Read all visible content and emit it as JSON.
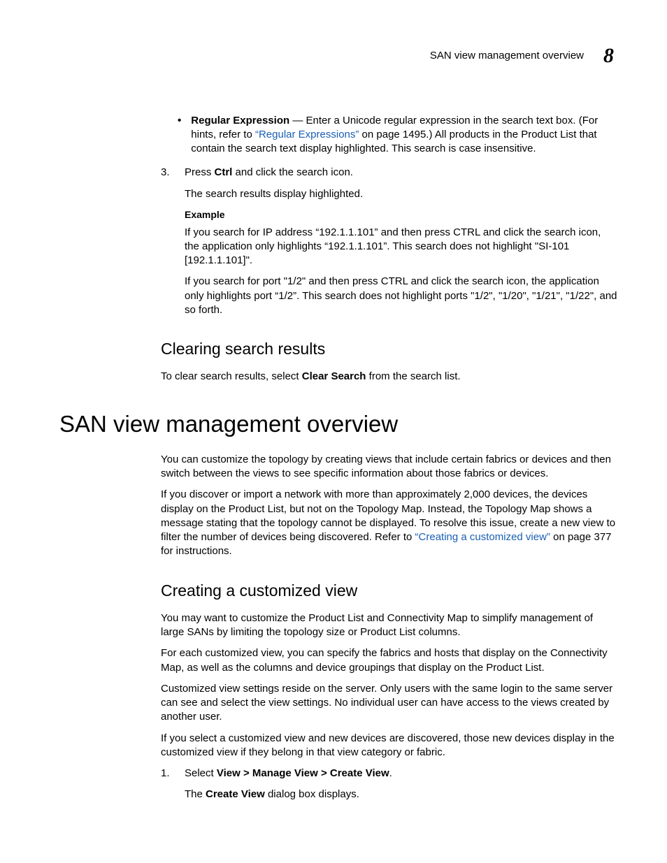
{
  "runningHead": {
    "title": "SAN view management overview",
    "chapter": "8"
  },
  "bullet": {
    "lead": "Regular Expression",
    "before": " — Enter a Unicode regular expression in the search text box. (For hints, refer to ",
    "link": "“Regular Expressions”",
    "after": " on page 1495.) All products in the Product List that contain the search text display highlighted. This search is case insensitive."
  },
  "step3": {
    "num": "3.",
    "pre": "Press ",
    "bold": "Ctrl",
    "post": " and click the search icon.",
    "result": "The search results display highlighted.",
    "exampleLabel": "Example",
    "ex1": "If you search for IP address “192.1.1.101” and then press CTRL and click the search icon, the application only highlights “192.1.1.101”. This search does not highlight \"SI-101 [192.1.1.101]\".",
    "ex2": "If you search for port \"1/2\" and then press CTRL and click the search icon, the application only highlights port “1/2”. This search does not highlight ports \"1/2\", \"1/20\", \"1/21\", \"1/22\", and so forth."
  },
  "clearing": {
    "heading": "Clearing search results",
    "pre": "To clear search results, select ",
    "bold": "Clear Search",
    "post": " from the search list."
  },
  "overview": {
    "heading": "SAN view management overview",
    "p1": "You can customize the topology by creating views that include certain fabrics or devices and then switch between the views to see specific information about those fabrics or devices.",
    "p2pre": "If you discover or import a network with more than approximately 2,000 devices, the devices display on the Product List, but not on the Topology Map. Instead, the Topology Map shows a message stating that the topology cannot be displayed. To resolve this issue, create a new view to filter the number of devices being discovered. Refer to ",
    "p2link": "“Creating a customized view”",
    "p2post": " on page 377 for instructions."
  },
  "creating": {
    "heading": "Creating a customized view",
    "p1": "You may want to customize the Product List and Connectivity Map to simplify management of large SANs by limiting the topology size or Product List columns.",
    "p2": "For each customized view, you can specify the fabrics and hosts that display on the Connectivity Map, as well as the columns and device groupings that display on the Product List.",
    "p3": "Customized view settings reside on the server. Only users with the same login to the same server can see and select the view settings. No individual user can have access to the views created by another user.",
    "p4": "If you select a customized view and new devices are discovered, those new devices display in the customized view if they belong in that view category or fabric.",
    "step1num": "1.",
    "step1pre": "Select ",
    "step1bold": "View > Manage View > Create View",
    "step1post": ".",
    "step1resultPre": "The ",
    "step1resultBold": "Create View",
    "step1resultPost": " dialog box displays."
  }
}
